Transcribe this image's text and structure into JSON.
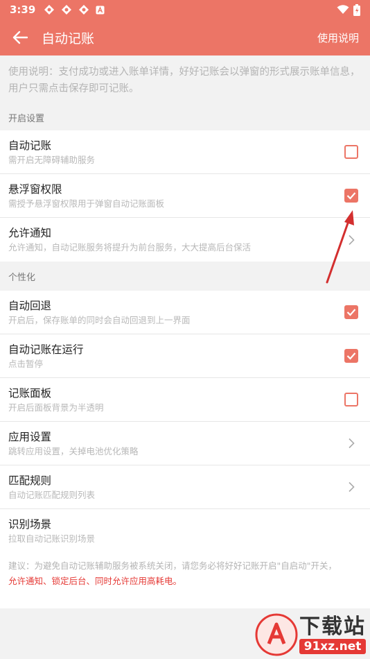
{
  "status_bar": {
    "time": "3:39"
  },
  "app_bar": {
    "title": "自动记账",
    "help_label": "使用说明"
  },
  "description": "使用说明：支付成功或进入账单详情，好好记账会以弹窗的形式展示账单信息，用户只需点击保存即可记账。",
  "sections": [
    {
      "header": "开启设置",
      "items": [
        {
          "title": "自动记账",
          "subtitle": "需开启无障碍辅助服务",
          "control": "checkbox",
          "checked": false
        },
        {
          "title": "悬浮窗权限",
          "subtitle": "需授予悬浮窗权限用于弹窗自动记账面板",
          "control": "checkbox",
          "checked": true
        },
        {
          "title": "允许通知",
          "subtitle": "允许通知，自动记账服务将提升为前台服务，大大提高后台保活",
          "control": "chevron"
        }
      ]
    },
    {
      "header": "个性化",
      "items": [
        {
          "title": "自动回退",
          "subtitle": "开启后，保存账单的同时会自动回退到上一界面",
          "control": "checkbox",
          "checked": true
        },
        {
          "title": "自动记账在运行",
          "subtitle": "点击暂停",
          "control": "checkbox",
          "checked": true
        },
        {
          "title": "记账面板",
          "subtitle": "开启后面板背景为半透明",
          "control": "checkbox",
          "checked": false
        },
        {
          "title": "应用设置",
          "subtitle": "跳转应用设置，关掉电池优化策略",
          "control": "chevron"
        },
        {
          "title": "匹配规则",
          "subtitle": "自动记账匹配规则列表",
          "control": "chevron"
        },
        {
          "title": "识别场景",
          "subtitle": "拉取自动记账识别场景",
          "control": "none"
        }
      ]
    }
  ],
  "notice": {
    "line1": "建议：为避免自动记账辅助服务被系统关闭，请您务必将好好记账开启\"自启动\"开关，",
    "line2": "允许通知、锁定后台、同时允许应用高耗电。"
  },
  "watermark": {
    "text_top": "下载站",
    "text_bottom": "91xz.net"
  },
  "colors": {
    "accent": "#ec7566",
    "warning": "#e53935",
    "annotation_arrow": "#d32f2f"
  }
}
